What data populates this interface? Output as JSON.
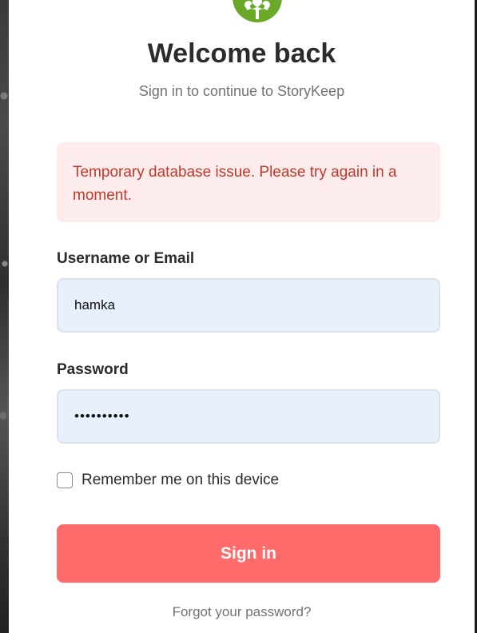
{
  "app": {
    "brand_color": "#6aa828",
    "logo_icon": "tree-icon"
  },
  "header": {
    "title": "Welcome back",
    "subtitle": "Sign in to continue to StoryKeep"
  },
  "alert": {
    "message": "Temporary database issue. Please try again in a moment.",
    "background": "#fdecec",
    "text_color": "#c0392b"
  },
  "form": {
    "username_label": "Username or Email",
    "username_value": "hamka",
    "password_label": "Password",
    "password_value": "••••••••••",
    "remember_label": "Remember me on this device",
    "remember_checked": false,
    "submit_label": "Sign in",
    "submit_color": "#ff6b6b",
    "forgot_label": "Forgot your password?"
  }
}
